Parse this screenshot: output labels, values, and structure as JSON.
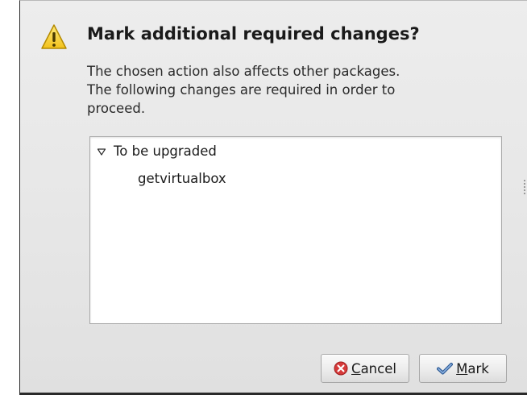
{
  "dialog": {
    "title": "Mark additional required changes?",
    "message_lines": [
      "The chosen action also affects other packages.",
      "The following changes are required in order to",
      "proceed."
    ],
    "icon": "warning-icon"
  },
  "changes": {
    "group_label": "To be upgraded",
    "expander_icon": "triangle-down-icon",
    "items": [
      "getvirtualbox"
    ]
  },
  "buttons": {
    "cancel": {
      "mnemonic": "C",
      "rest": "ancel",
      "icon": "cancel-icon",
      "icon_color": "#d63a3a"
    },
    "mark": {
      "mnemonic": "M",
      "rest": "ark",
      "icon": "checkmark-icon",
      "icon_color": "#4a78b8"
    }
  },
  "colors": {
    "warning_fill": "#f5d442",
    "warning_border": "#b48a00"
  }
}
